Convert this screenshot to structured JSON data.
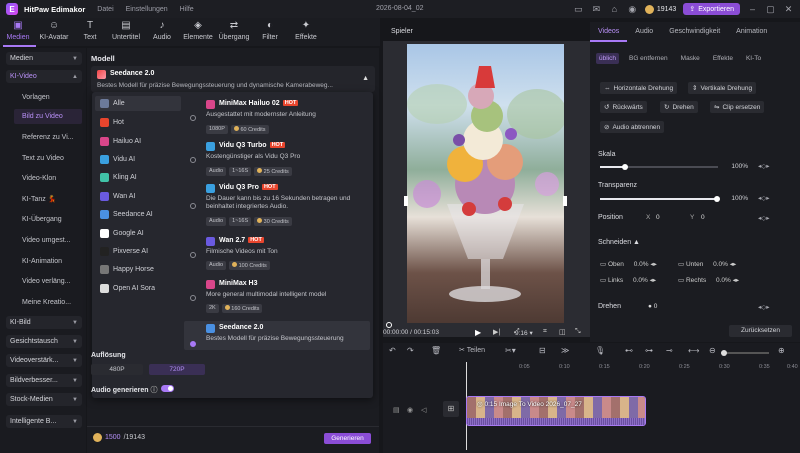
{
  "app": {
    "name": "HitPaw Edimakor",
    "menus": [
      "Datei",
      "Einstellungen",
      "Hilfe"
    ],
    "date": "2026-08-04_02",
    "credits": "19143",
    "export_label": "Exportieren"
  },
  "toolbar": {
    "items": [
      "Medien",
      "KI-Avatar",
      "Text",
      "Untertitel",
      "Audio",
      "Elemente",
      "Übergang",
      "Filter",
      "Effekte"
    ],
    "active": "Medien"
  },
  "sidebar": {
    "groups": [
      {
        "label": "Medien"
      },
      {
        "label": "KI-Video"
      },
      {
        "label": "KI-Bild"
      },
      {
        "label": "Gesichtstausch"
      },
      {
        "label": "Videoverstärk..."
      },
      {
        "label": "Bildverbesser..."
      },
      {
        "label": "Stock-Medien"
      },
      {
        "label": "Intelligente B..."
      }
    ],
    "subitems": [
      "Vorlagen",
      "Bild zu Video",
      "Referenz zu Vi...",
      "Text zu Video",
      "Video-Klon",
      "KI-Tanz 💃",
      "KI-Übergang",
      "Video umgest...",
      "KI-Animation",
      "Video verläng...",
      "Meine Kreatio..."
    ],
    "selected_sub": "Bild zu Video"
  },
  "panel": {
    "title": "Modell",
    "current_model": {
      "name": "Seedance 2.0",
      "desc": "Bestes Modell für präzise Bewegungssteuerung und dynamische Kamerabeweg..."
    },
    "providers": [
      "Alle",
      "Hot",
      "Hailuo AI",
      "Vidu AI",
      "Kling AI",
      "Wan AI",
      "Seedance AI",
      "Google AI",
      "Pixverse AI",
      "Happy Horse",
      "Open AI Sora"
    ],
    "selected_provider": "Alle",
    "models": [
      {
        "name": "MiniMax Hailuo 02",
        "hot": "HOT",
        "desc": "Ausgestattet mit modernster Anleitung",
        "tags": [
          "1080P",
          "60 Credits"
        ]
      },
      {
        "name": "Vidu Q3 Turbo",
        "hot": "HOT",
        "desc": "Kostengünstiger als Vidu Q3 Pro",
        "tags": [
          "Audio",
          "1~16S",
          "25 Credits"
        ]
      },
      {
        "name": "Vidu Q3 Pro",
        "hot": "HOT",
        "desc": "Die Dauer kann bis zu 16 Sekunden betragen und beinhaltet integriertes Audio.",
        "tags": [
          "Audio",
          "1~16S",
          "30 Credits"
        ]
      },
      {
        "name": "Wan 2.7",
        "hot": "HOT",
        "desc": "Filmische Videos mit Ton",
        "tags": [
          "Audio",
          "100 Credits"
        ]
      },
      {
        "name": "MiniMax H3",
        "hot": "",
        "desc": "More general multimodal intelligent model",
        "tags": [
          "2K",
          "160 Credits"
        ]
      },
      {
        "name": "Seedance 2.0",
        "hot": "",
        "desc": "Bestes Modell für präzise Bewegungssteuerung",
        "tags": []
      }
    ],
    "resolution_label": "Auflösung",
    "resolutions": [
      "480P",
      "720P"
    ],
    "selected_resolution": "720P",
    "audio_label": "Audio generieren",
    "audio_on": true,
    "credit_text": "1500",
    "credit_total": "/19143",
    "generate_label": "Generieren"
  },
  "player": {
    "label": "Spieler",
    "time_current": "00:00:00",
    "time_total": "/ 00:15:03",
    "ratio": "9:16"
  },
  "inspector": {
    "tabs": [
      "Videos",
      "Audio",
      "Geschwindigkeit",
      "Animation"
    ],
    "selected_tab": "Videos",
    "subtabs": [
      "üblich",
      "BG entfernen",
      "Maske",
      "Effekte",
      "KI-To"
    ],
    "selected_subtab": "üblich",
    "buttons": [
      "Horizontale Drehung",
      "Vertikale Drehung",
      "Rückwärts",
      "Drehen",
      "Clip ersetzen",
      "Audio abtrennen"
    ],
    "scale_label": "Skala",
    "scale_value": "100%",
    "opacity_label": "Transparenz",
    "opacity_value": "100%",
    "position_label": "Position",
    "pos_x_label": "X",
    "pos_x": "0",
    "pos_y_label": "Y",
    "pos_y": "0",
    "crop_label": "Schneiden",
    "crop": [
      {
        "label": "Oben",
        "value": "0.0%"
      },
      {
        "label": "Unten",
        "value": "0.0%"
      },
      {
        "label": "Links",
        "value": "0.0%"
      },
      {
        "label": "Rechts",
        "value": "0.0%"
      }
    ],
    "rotate_label": "Drehen",
    "rotate_value": "0",
    "reset_label": "Zurücksetzen"
  },
  "timeline": {
    "split_label": "Teilen",
    "ticks": [
      "0:05",
      "0:10",
      "0:15",
      "0:20",
      "0:25",
      "0:30",
      "0:35",
      "0:40"
    ],
    "clip_label": "0:15 Image To Video 2026_07_27"
  },
  "colors": {
    "accent": "#a879f5",
    "export": "#8b4dd6",
    "hot": "#e8452d"
  }
}
